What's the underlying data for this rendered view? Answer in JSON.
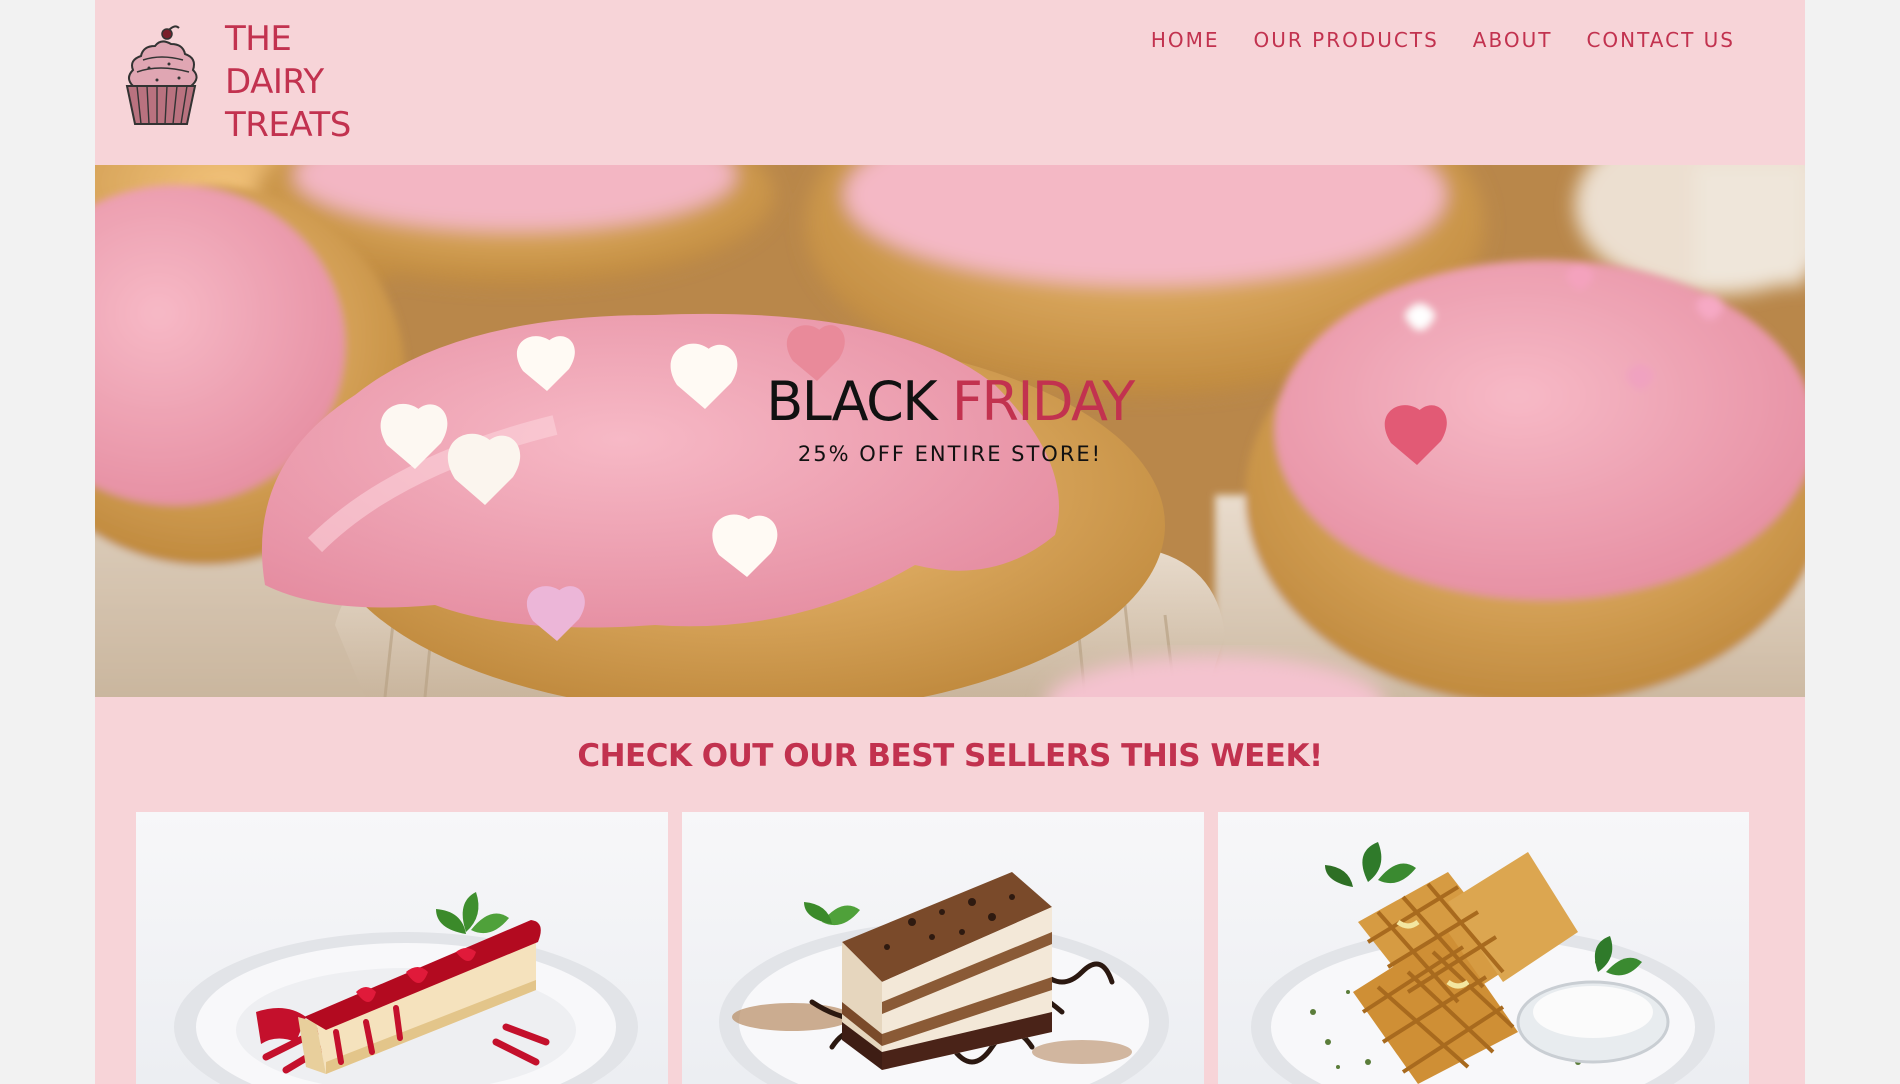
{
  "brand": {
    "lines": [
      "THE",
      "DAIRY",
      "TREATS"
    ],
    "logo_icon": "cupcake-icon",
    "accent_color": "#c2324f",
    "background_color": "#f7d4d8"
  },
  "nav": {
    "items": [
      {
        "label": "HOME"
      },
      {
        "label": "OUR PRODUCTS"
      },
      {
        "label": "ABOUT"
      },
      {
        "label": "CONTACT US"
      }
    ]
  },
  "hero": {
    "title_word_1": "BLACK",
    "title_word_2": "FRIDAY",
    "subtitle": "25% OFF ENTIRE STORE!"
  },
  "best_sellers": {
    "heading": "CHECK OUT OUR BEST SELLERS THIS WEEK!"
  }
}
